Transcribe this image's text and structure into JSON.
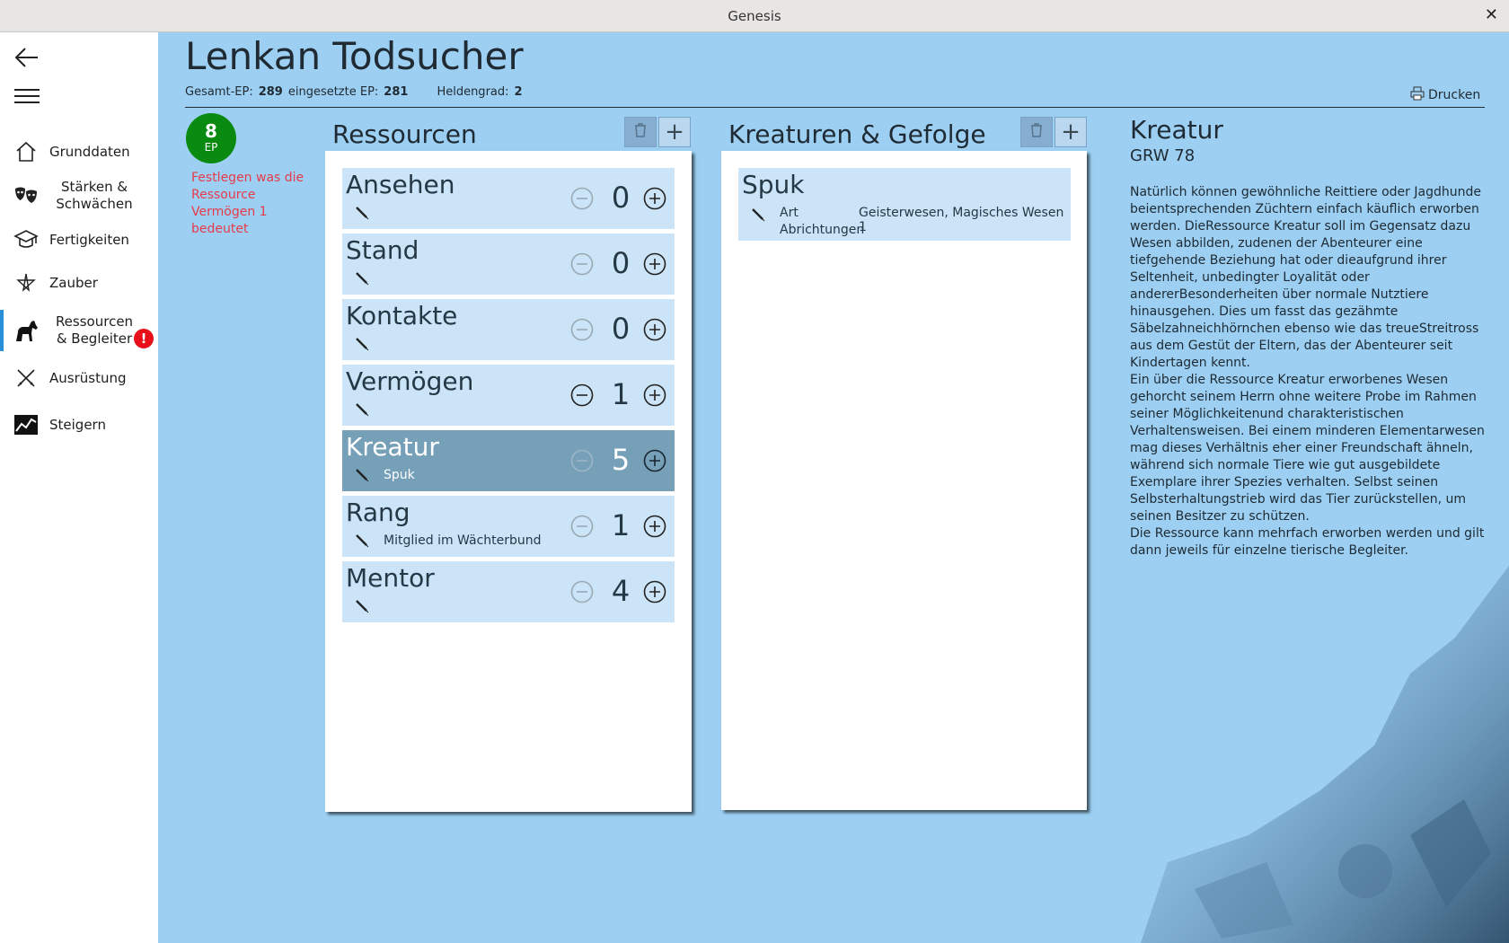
{
  "window": {
    "title": "Genesis",
    "close_glyph": "✕"
  },
  "sidebar": {
    "items": [
      {
        "label": "Grunddaten",
        "icon": "home-icon"
      },
      {
        "label": "Stärken & Schwächen",
        "icon": "masks-icon"
      },
      {
        "label": "Fertigkeiten",
        "icon": "graduation-cap-icon"
      },
      {
        "label": "Zauber",
        "icon": "pentagram-icon"
      },
      {
        "label": "Ressourcen & Begleiter",
        "icon": "horse-icon",
        "active": true,
        "alert": "!"
      },
      {
        "label": "Ausrüstung",
        "icon": "crossed-swords-icon"
      },
      {
        "label": "Steigern",
        "icon": "chart-icon"
      }
    ]
  },
  "header": {
    "name": "Lenkan Todsucher",
    "gesamt_ep_label": "Gesamt-EP:",
    "gesamt_ep": "289",
    "eingesetzte_ep_label": "eingesetzte EP:",
    "eingesetzte_ep": "281",
    "heldengrad_label": "Heldengrad:",
    "heldengrad": "2",
    "print_label": "Drucken"
  },
  "ep_badge": {
    "value": "8",
    "label": "EP",
    "color": "#0b8a12"
  },
  "warning": "Festlegen was die Ressource Vermögen 1 bedeutet",
  "resources": {
    "title": "Ressourcen",
    "rows": [
      {
        "name": "Ansehen",
        "desc": "",
        "value": "0",
        "selected": false,
        "minus_enabled": false
      },
      {
        "name": "Stand",
        "desc": "",
        "value": "0",
        "selected": false,
        "minus_enabled": false
      },
      {
        "name": "Kontakte",
        "desc": "",
        "value": "0",
        "selected": false,
        "minus_enabled": false
      },
      {
        "name": "Vermögen",
        "desc": "",
        "value": "1",
        "selected": false,
        "minus_enabled": true
      },
      {
        "name": "Kreatur",
        "desc": "Spuk",
        "value": "5",
        "selected": true,
        "minus_enabled": false
      },
      {
        "name": "Rang",
        "desc": "Mitglied im Wächterbund",
        "value": "1",
        "selected": false,
        "minus_enabled": false
      },
      {
        "name": "Mentor",
        "desc": "",
        "value": "4",
        "selected": false,
        "minus_enabled": false
      }
    ]
  },
  "creatures": {
    "title": "Kreaturen & Gefolge",
    "items": [
      {
        "name": "Spuk",
        "art_label": "Art",
        "art_value": "Geisterwesen, Magisches Wesen 1",
        "abrichtungen_label": "Abrichtungen"
      }
    ]
  },
  "detail": {
    "title": "Kreatur",
    "subtitle": "GRW 78",
    "paragraphs": [
      "Natürlich können gewöhnliche Reittiere oder Jagdhunde beientsprechenden Züchtern einfach käuflich erworben werden. DieRessource Kreatur soll im Gegensatz dazu Wesen abbilden, zudenen der Abenteurer eine tiefgehende Beziehung hat oder dieaufgrund ihrer Seltenheit, unbedingter Loyalität oder andererBesonderheiten über normale Nutztiere hinausgehen. Dies um fasst das gezähmte Säbelzahneichhörnchen ebenso wie das treueStreitross aus dem Gestüt der Eltern, das der Abenteurer seit Kindertagen kennt.",
      "Ein über die Ressource Kreatur erworbenes Wesen gehorcht seinem Herrn ohne weitere Probe im Rahmen seiner Möglichkeitenund charakteristischen Verhaltensweisen. Bei einem minderen Elementarwesen mag dieses Verhältnis eher einer Freundschaft ähneln, während sich normale Tiere wie gut ausgebildete Exemplare ihrer Spezies verhalten. Selbst seinen Selbsterhaltungstrieb wird das Tier zurückstellen, um seinen Besitzer zu schützen.",
      "Die Ressource kann mehrfach erworben werden und gilt dann jeweils für einzelne tierische Begleiter."
    ]
  },
  "colors": {
    "background": "#9ccff2",
    "row": "#cbe4f7",
    "row_selected": "#769fb8",
    "accent": "#2a8fd6",
    "alert": "#e8101a",
    "warning_text": "#e83a4a"
  }
}
